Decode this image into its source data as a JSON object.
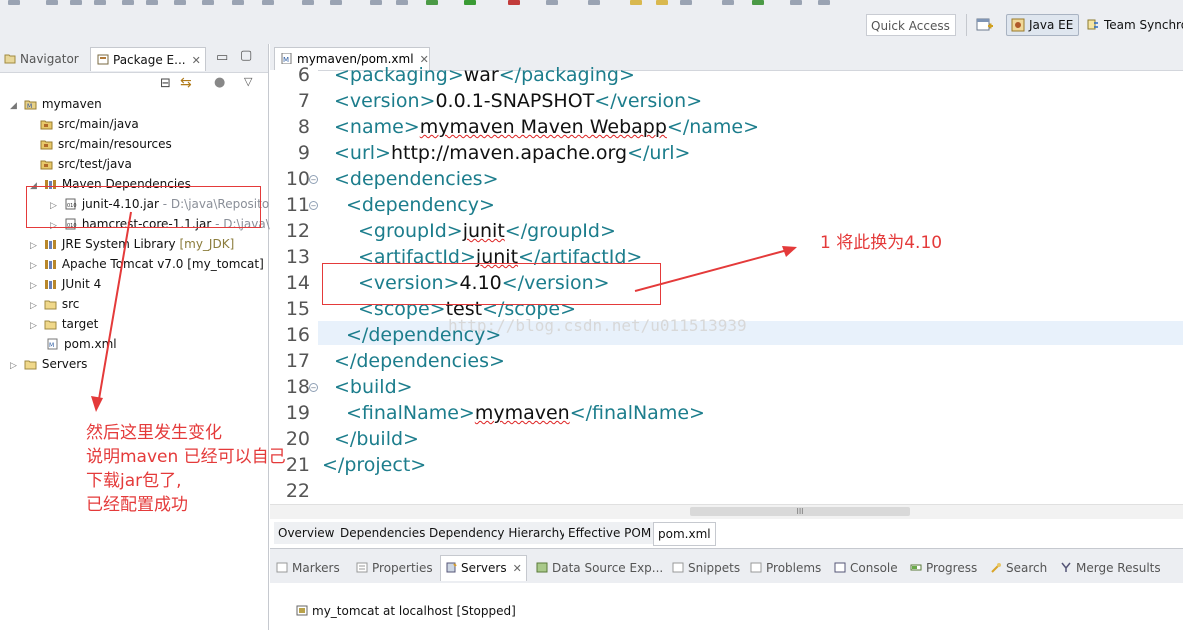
{
  "toolbar": {
    "quick_access": "Quick Access",
    "perspective_active": "Java EE",
    "perspective_other": "Team Synchro"
  },
  "left_panel": {
    "tabs": [
      {
        "label": "Navigator"
      },
      {
        "label": "Package E..."
      }
    ],
    "tree": [
      {
        "label": "mymaven",
        "icon": "maven-project-icon"
      },
      {
        "label": "src/main/java",
        "icon": "source-folder-icon"
      },
      {
        "label": "src/main/resources",
        "icon": "source-folder-icon"
      },
      {
        "label": "src/test/java",
        "icon": "source-folder-icon"
      },
      {
        "label": "Maven Dependencies",
        "icon": "library-icon"
      },
      {
        "label": "junit-4.10.jar",
        "suffix": "- D:\\java\\Reposito",
        "icon": "jar-icon"
      },
      {
        "label": "hamcrest-core-1.1.jar",
        "suffix": "- D:\\java\\",
        "icon": "jar-icon"
      },
      {
        "label": "JRE System Library",
        "suffix": "[my_JDK]",
        "icon": "library-icon"
      },
      {
        "label": "Apache Tomcat v7.0",
        "suffix": "[my_tomcat]",
        "icon": "library-icon"
      },
      {
        "label": "JUnit 4",
        "icon": "library-icon"
      },
      {
        "label": "src",
        "icon": "folder-icon"
      },
      {
        "label": "target",
        "icon": "folder-icon"
      },
      {
        "label": "pom.xml",
        "icon": "xml-file-icon"
      },
      {
        "label": "Servers",
        "icon": "folder-icon"
      }
    ]
  },
  "editor": {
    "tab_label": "mymaven/pom.xml",
    "line_numbers": [
      "6",
      "7",
      "8",
      "9",
      "10",
      "11",
      "12",
      "13",
      "14",
      "15",
      "16",
      "17",
      "18",
      "19",
      "20",
      "21",
      "22"
    ],
    "lines": [
      {
        "open": "<packaging>",
        "text": "war",
        "close": "</packaging>"
      },
      {
        "open": "<version>",
        "text": "0.0.1-SNAPSHOT",
        "close": "</version>"
      },
      {
        "open": "<name>",
        "text": "mymaven Maven Webapp",
        "close": "</name>"
      },
      {
        "open": "<url>",
        "text": "http://maven.apache.org",
        "close": "</url>"
      },
      {
        "open": "<dependencies>",
        "text": "",
        "close": ""
      },
      {
        "open": "<dependency>",
        "text": "",
        "close": ""
      },
      {
        "open": "<groupId>",
        "text": "junit",
        "close": "</groupId>"
      },
      {
        "open": "<artifactId>",
        "text": "junit",
        "close": "</artifactId>"
      },
      {
        "open": "<version>",
        "text": "4.10",
        "close": "</version>"
      },
      {
        "open": "<scope>",
        "text": "test",
        "close": "</scope>"
      },
      {
        "open": "</dependency>",
        "text": "",
        "close": ""
      },
      {
        "open": "</dependencies>",
        "text": "",
        "close": ""
      },
      {
        "open": "<build>",
        "text": "",
        "close": ""
      },
      {
        "open": "<finalName>",
        "text": "mymaven",
        "close": "</finalName>"
      },
      {
        "open": "</build>",
        "text": "",
        "close": ""
      },
      {
        "open": "</project>",
        "text": "",
        "close": ""
      },
      {
        "open": "",
        "text": "",
        "close": ""
      }
    ],
    "subtabs": [
      "Overview",
      "Dependencies",
      "Dependency Hierarchy",
      "Effective POM",
      "pom.xml"
    ],
    "scroll_marker": "III",
    "watermark": "http://blog.csdn.net/u011513939"
  },
  "bottom_panel": {
    "tabs": [
      "Markers",
      "Properties",
      "Servers",
      "Data Source Exp...",
      "Snippets",
      "Problems",
      "Console",
      "Progress",
      "Search",
      "Merge Results"
    ],
    "server": "my_tomcat at localhost  [Stopped]"
  },
  "annotations": {
    "note1": "1 将此换为4.10",
    "note2_lines": [
      "然后这里发生变化",
      "说明maven 已经可以自己",
      "下载jar包了,",
      "已经配置成功"
    ]
  },
  "colors": {
    "tag": "#1c7d8c",
    "annotation_red": "#e43a3a",
    "toolbar_bg": "#eceef2",
    "current_line": "#e8f1fb"
  }
}
